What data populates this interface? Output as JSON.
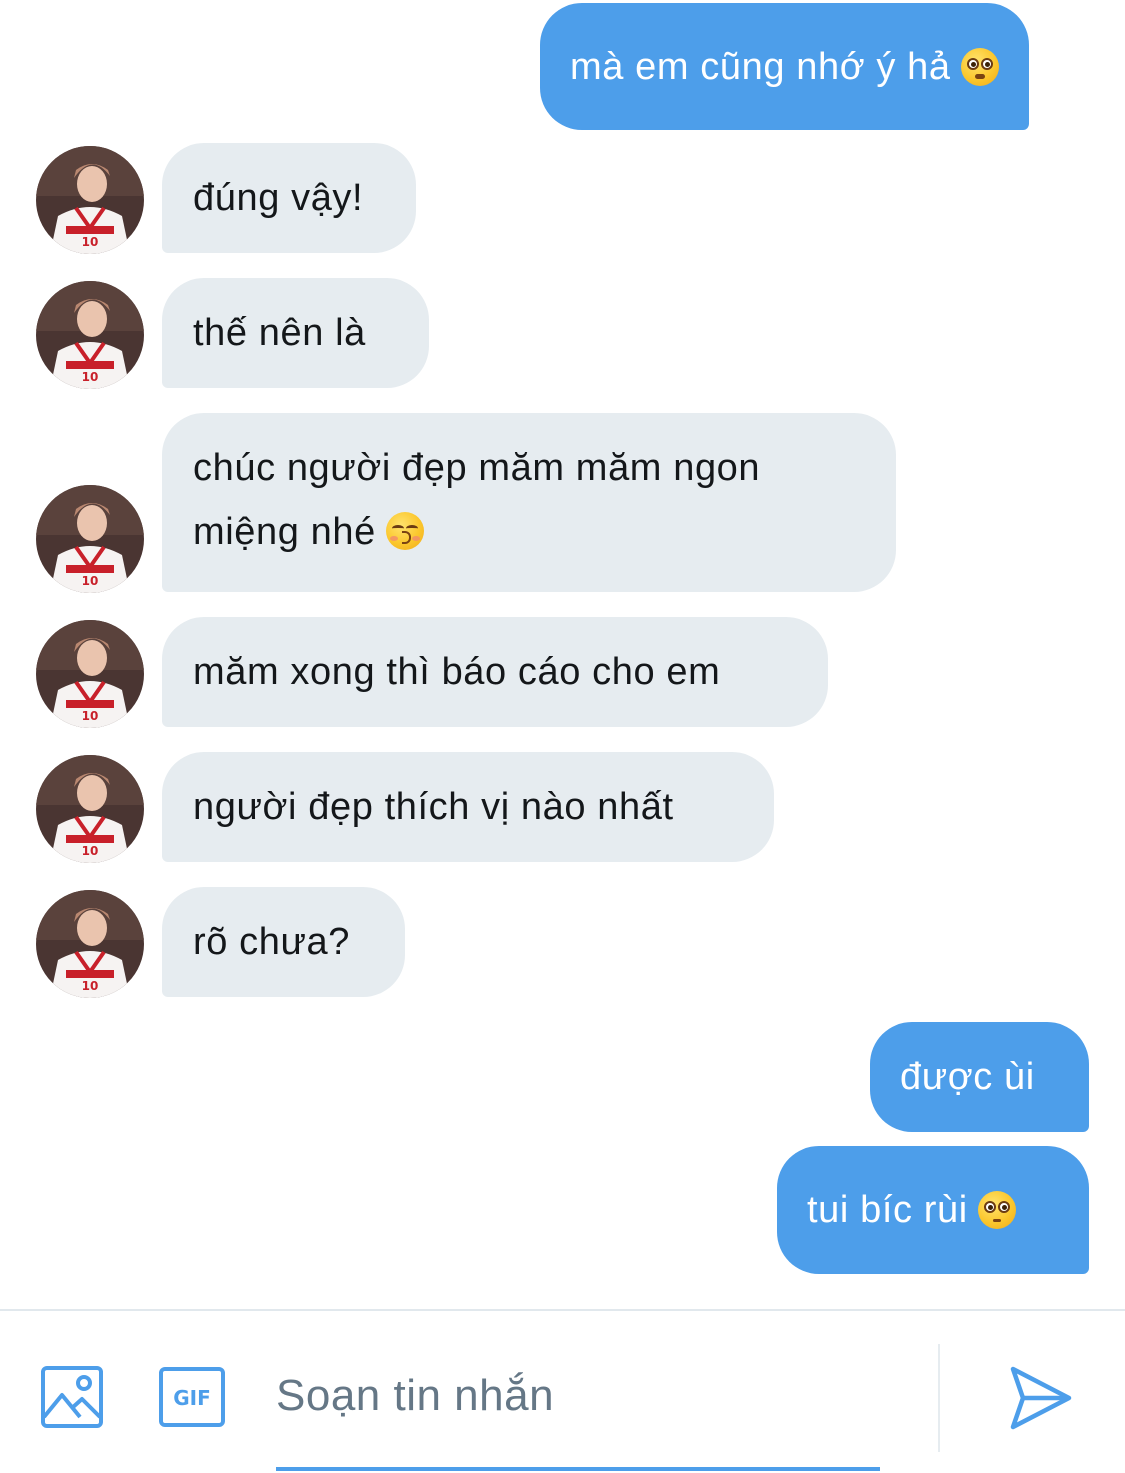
{
  "colors": {
    "outgoing_bubble": "#4d9eea",
    "incoming_bubble": "#e6ecf0",
    "accent": "#4d9eea"
  },
  "messages": [
    {
      "direction": "out",
      "text": "mà em cũng nhớ ý hả",
      "emoji": "flushed-face"
    },
    {
      "direction": "in",
      "text": "đúng vậy!"
    },
    {
      "direction": "in",
      "text": "thế nên là"
    },
    {
      "direction": "in",
      "lines": [
        "chúc người đẹp măm măm ngon",
        "miệng nhé"
      ],
      "emoji": "kissing-face-smiling-eyes"
    },
    {
      "direction": "in",
      "text": "măm xong thì báo cáo cho em"
    },
    {
      "direction": "in",
      "text": "người đẹp thích vị nào nhất"
    },
    {
      "direction": "in",
      "text": "rõ chưa?"
    },
    {
      "direction": "out",
      "text": "được ùi"
    },
    {
      "direction": "out",
      "text": "tui bíc rùi",
      "emoji": "pleading-face"
    }
  ],
  "composer": {
    "placeholder": "Soạn tin nhắn",
    "value": "",
    "media_icon": "image-icon",
    "gif_label": "GIF",
    "send_icon": "send-icon"
  }
}
